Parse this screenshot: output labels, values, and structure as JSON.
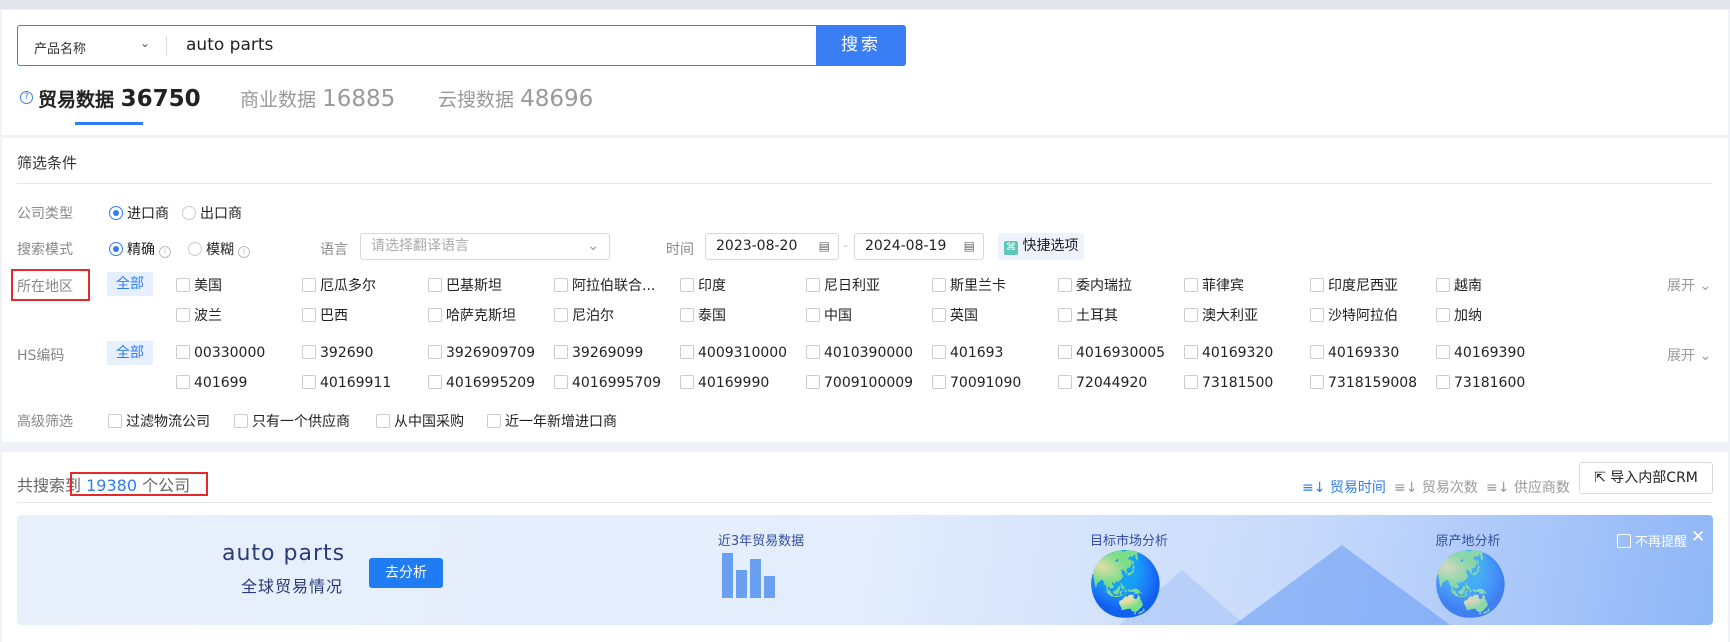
{
  "search": {
    "field_select": "产品名称",
    "query": "auto parts",
    "button": "搜索"
  },
  "tabs": [
    {
      "label": "贸易数据",
      "count": "36750",
      "active": true
    },
    {
      "label": "商业数据",
      "count": "16885"
    },
    {
      "label": "云搜数据",
      "count": "48696"
    }
  ],
  "filters": {
    "title": "筛选条件",
    "company_type": {
      "label": "公司类型",
      "options": [
        "进口商",
        "出口商"
      ],
      "selected": "进口商"
    },
    "search_mode": {
      "label": "搜索模式",
      "options": [
        "精确",
        "模糊"
      ],
      "selected": "精确"
    },
    "language": {
      "label": "语言",
      "placeholder": "请选择翻译语言"
    },
    "time": {
      "label": "时间",
      "start": "2023-08-20",
      "end": "2024-08-19",
      "separator": "-",
      "quick": "快捷选项"
    },
    "region": {
      "label": "所在地区",
      "all": "全部",
      "expand": "展开",
      "items": [
        "美国",
        "厄瓜多尔",
        "巴基斯坦",
        "阿拉伯联合...",
        "印度",
        "尼日利亚",
        "斯里兰卡",
        "委内瑞拉",
        "菲律宾",
        "印度尼西亚",
        "越南",
        "波兰",
        "巴西",
        "哈萨克斯坦",
        "尼泊尔",
        "泰国",
        "中国",
        "英国",
        "土耳其",
        "澳大利亚",
        "沙特阿拉伯",
        "加纳"
      ]
    },
    "hs": {
      "label": "HS编码",
      "all": "全部",
      "expand": "展开",
      "items": [
        "00330000",
        "392690",
        "3926909709",
        "39269099",
        "4009310000",
        "4010390000",
        "401693",
        "4016930005",
        "40169320",
        "40169330",
        "40169390",
        "401699",
        "40169911",
        "4016995209",
        "4016995709",
        "40169990",
        "7009100009",
        "70091090",
        "72044920",
        "73181500",
        "7318159008",
        "73181600"
      ]
    },
    "advanced": {
      "label": "高级筛选",
      "items": [
        "过滤物流公司",
        "只有一个供应商",
        "从中国采购",
        "近一年新增进口商"
      ]
    }
  },
  "results": {
    "prefix": "共搜索到",
    "count": "19380",
    "suffix": "个公司",
    "sorts": [
      {
        "label": "贸易时间",
        "active": true
      },
      {
        "label": "贸易次数"
      },
      {
        "label": "供应商数"
      }
    ],
    "crm_button": "导入内部CRM"
  },
  "banner": {
    "keyword": "auto parts",
    "subtitle": "全球贸易情况",
    "analyze_button": "去分析",
    "section1": "近3年贸易数据",
    "section2": "目标市场分析",
    "section3": "原产地分析",
    "dismiss": "不再提醒",
    "bar_levels": [
      1.0,
      0.62,
      0.86,
      0.48
    ]
  },
  "colors": {
    "accent": "#2f7cf6",
    "highlight_box": "#e8282b"
  }
}
